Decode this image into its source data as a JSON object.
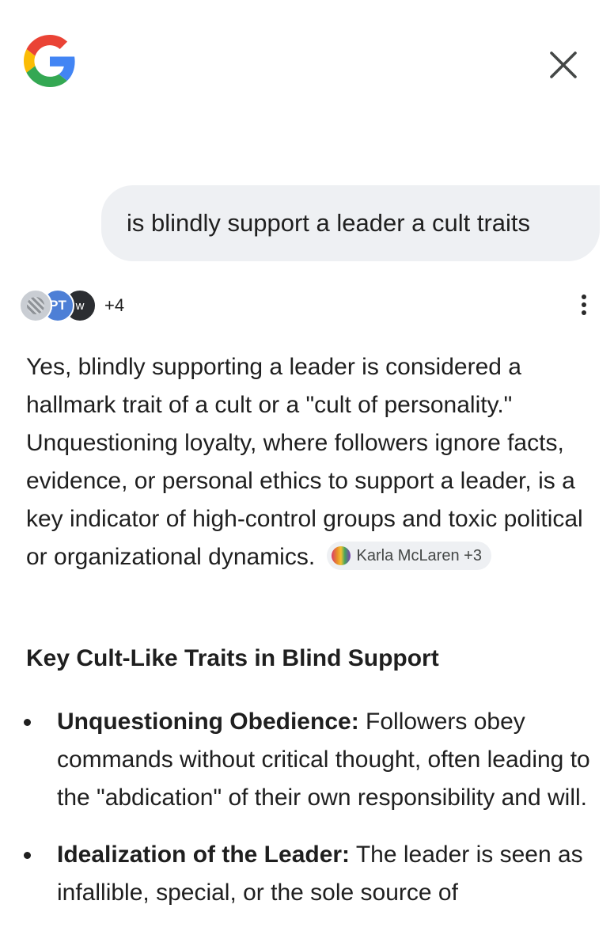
{
  "header": {
    "logo_icon": "google-g-icon",
    "close_icon": "close-icon"
  },
  "query": {
    "text": "is blindly support a leader a cult traits"
  },
  "sources": {
    "icons": [
      {
        "name": "source-1-icon",
        "label": ""
      },
      {
        "name": "source-2-icon",
        "label": "PT"
      },
      {
        "name": "source-3-icon",
        "label": "w"
      }
    ],
    "more_label": "+4",
    "menu_icon": "more-vert-icon"
  },
  "answer": {
    "paragraph": "Yes, blindly supporting a leader is considered a hallmark trait of a cult or a \"cult of personality.\" Unquestioning loyalty, where followers ignore facts, evidence, or personal ethics to support a leader, is a key indicator of high-control groups and toxic political or organizational dynamics.",
    "citation_label": "Karla McLaren +3"
  },
  "section": {
    "heading": "Key Cult-Like Traits in Blind Support"
  },
  "bullets": [
    {
      "term": "Unquestioning Obedience:",
      "text": " Followers obey commands without critical thought, often leading to the \"abdication\" of their own responsibility and will."
    },
    {
      "term": "Idealization of the Leader:",
      "text": " The leader is seen as infallible, special, or the sole source of"
    }
  ]
}
